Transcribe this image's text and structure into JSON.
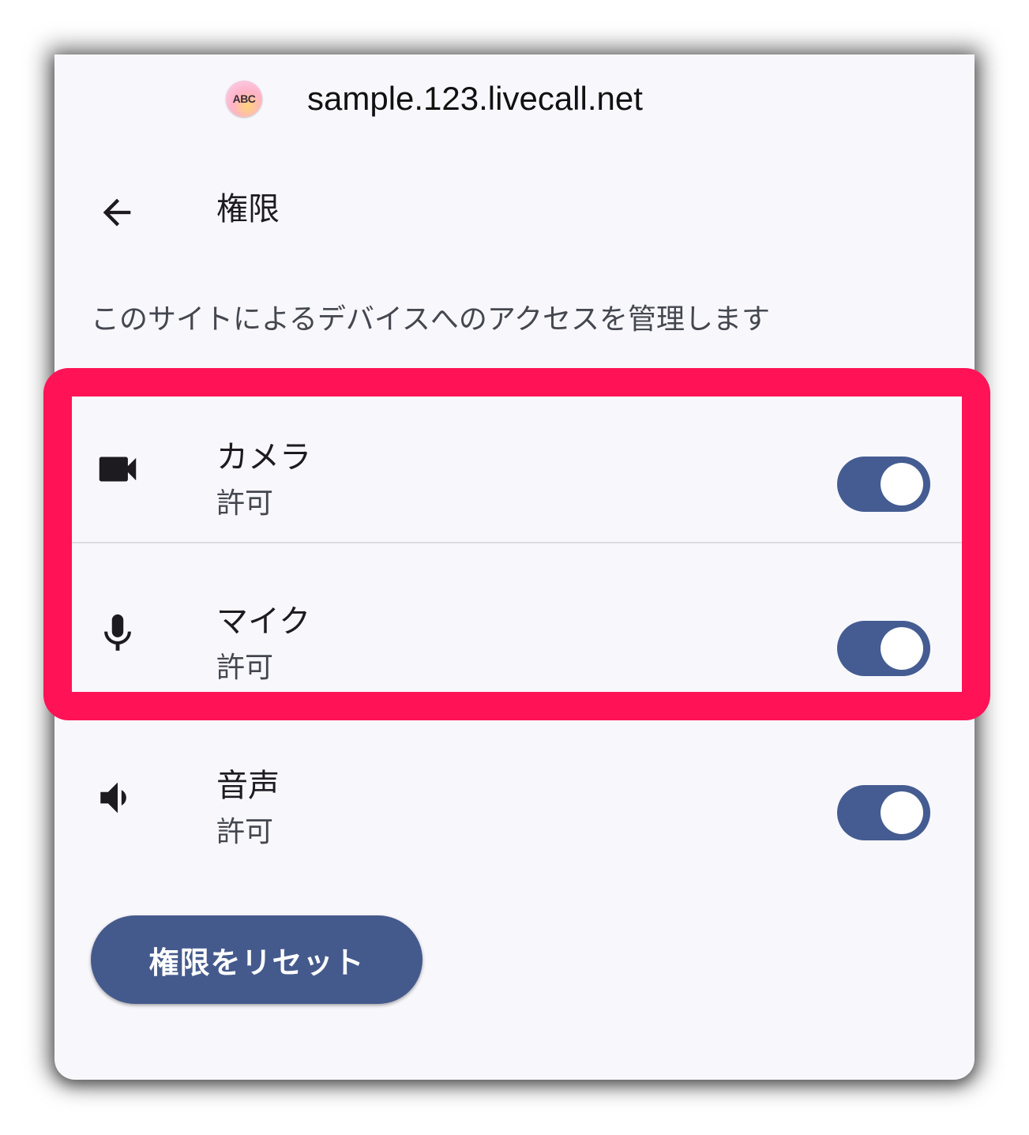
{
  "site": {
    "favicon_text": "ABC",
    "url": "sample.123.livecall.net"
  },
  "header": {
    "back_icon": "arrow-back-icon",
    "title": "権限"
  },
  "description": "このサイトによるデバイスへのアクセスを管理します",
  "permissions": [
    {
      "icon": "videocam-icon",
      "name": "カメラ",
      "status": "許可",
      "enabled": true
    },
    {
      "icon": "microphone-icon",
      "name": "マイク",
      "status": "許可",
      "enabled": true
    },
    {
      "icon": "volume-icon",
      "name": "音声",
      "status": "許可",
      "enabled": true
    }
  ],
  "reset_button_label": "権限をリセット",
  "colors": {
    "highlight": "#ff1256",
    "toggle_on": "#445c91",
    "button": "#455a8c",
    "panel_bg": "#f8f7fc"
  }
}
